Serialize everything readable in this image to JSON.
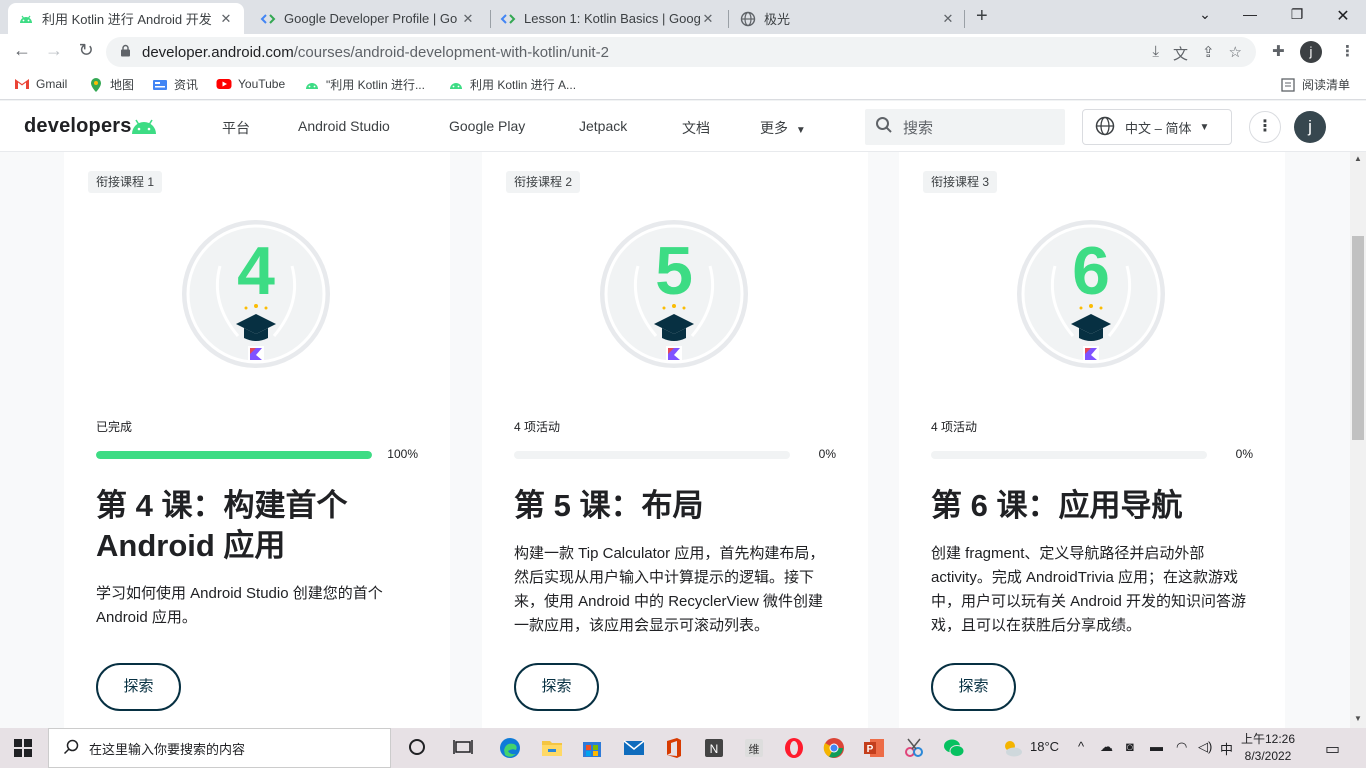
{
  "browser": {
    "tabs": [
      {
        "title": "利用 Kotlin 进行 Android 开发",
        "active": true
      },
      {
        "title": "Google Developer Profile | Go",
        "active": false
      },
      {
        "title": "Lesson 1: Kotlin Basics | Goog",
        "active": false
      },
      {
        "title": "极光",
        "active": false
      }
    ],
    "url_host": "developer.android.com",
    "url_path": "/courses/android-development-with-kotlin/unit-2",
    "profile_initial": "j",
    "bookmarks": [
      {
        "label": "Gmail"
      },
      {
        "label": "地图"
      },
      {
        "label": "资讯"
      },
      {
        "label": "YouTube"
      },
      {
        "label": "\"利用 Kotlin 进行..."
      },
      {
        "label": "利用 Kotlin 进行 A..."
      }
    ],
    "reading_list": "阅读清单"
  },
  "site": {
    "logo": "developers",
    "nav": [
      "平台",
      "Android Studio",
      "Google Play",
      "Jetpack",
      "文档",
      "更多"
    ],
    "search_placeholder": "搜索",
    "language": "中文 – 简体",
    "avatar_initial": "j"
  },
  "cards": [
    {
      "chip": "衔接课程 1",
      "badge_number": "4",
      "status": "已完成",
      "progress": 100,
      "progress_label": "100%",
      "title": "第 4 课：构建首个 Android 应用",
      "description": "学习如何使用 Android Studio 创建您的首个 Android 应用。",
      "button": "探索"
    },
    {
      "chip": "衔接课程 2",
      "badge_number": "5",
      "status": "4 项活动",
      "progress": 0,
      "progress_label": "0%",
      "title": "第 5 课：布局",
      "description": "构建一款 Tip Calculator 应用，首先构建布局，然后实现从用户输入中计算提示的逻辑。接下来，使用 Android 中的 RecyclerView 微件创建一款应用，该应用会显示可滚动列表。",
      "button": "探索"
    },
    {
      "chip": "衔接课程 3",
      "badge_number": "6",
      "status": "4 项活动",
      "progress": 0,
      "progress_label": "0%",
      "title": "第 6 课：应用导航",
      "description": "创建 fragment、定义导航路径并启动外部 activity。完成 AndroidTrivia 应用；在这款游戏中，用户可以玩有关 Android 开发的知识问答游戏，且可以在获胜后分享成绩。",
      "button": "探索"
    }
  ],
  "colors": {
    "android_green": "#3ddc84",
    "ink": "#073042"
  },
  "taskbar": {
    "search_placeholder": "在这里输入你要搜索的内容",
    "weather": "18°C",
    "ime": "中",
    "time": "上午12:26",
    "date": "8/3/2022"
  }
}
